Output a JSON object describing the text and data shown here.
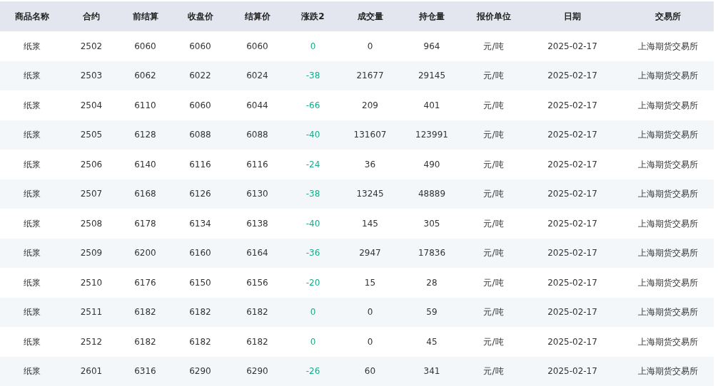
{
  "table": {
    "columns": [
      "商品名称",
      "合约",
      "前结算",
      "收盘价",
      "结算价",
      "涨跌2",
      "成交量",
      "持仓量",
      "报价单位",
      "日期",
      "交易所"
    ],
    "rows": [
      [
        "纸浆",
        "2502",
        "6060",
        "6060",
        "6060",
        "0",
        "0",
        "964",
        "元/吨",
        "2025-02-17",
        "上海期货交易所"
      ],
      [
        "纸浆",
        "2503",
        "6062",
        "6022",
        "6024",
        "-38",
        "21677",
        "29145",
        "元/吨",
        "2025-02-17",
        "上海期货交易所"
      ],
      [
        "纸浆",
        "2504",
        "6110",
        "6060",
        "6044",
        "-66",
        "209",
        "401",
        "元/吨",
        "2025-02-17",
        "上海期货交易所"
      ],
      [
        "纸浆",
        "2505",
        "6128",
        "6088",
        "6088",
        "-40",
        "131607",
        "123991",
        "元/吨",
        "2025-02-17",
        "上海期货交易所"
      ],
      [
        "纸浆",
        "2506",
        "6140",
        "6116",
        "6116",
        "-24",
        "36",
        "490",
        "元/吨",
        "2025-02-17",
        "上海期货交易所"
      ],
      [
        "纸浆",
        "2507",
        "6168",
        "6126",
        "6130",
        "-38",
        "13245",
        "48889",
        "元/吨",
        "2025-02-17",
        "上海期货交易所"
      ],
      [
        "纸浆",
        "2508",
        "6178",
        "6134",
        "6138",
        "-40",
        "145",
        "305",
        "元/吨",
        "2025-02-17",
        "上海期货交易所"
      ],
      [
        "纸浆",
        "2509",
        "6200",
        "6160",
        "6164",
        "-36",
        "2947",
        "17836",
        "元/吨",
        "2025-02-17",
        "上海期货交易所"
      ],
      [
        "纸浆",
        "2510",
        "6176",
        "6150",
        "6156",
        "-20",
        "15",
        "28",
        "元/吨",
        "2025-02-17",
        "上海期货交易所"
      ],
      [
        "纸浆",
        "2511",
        "6182",
        "6182",
        "6182",
        "0",
        "0",
        "59",
        "元/吨",
        "2025-02-17",
        "上海期货交易所"
      ],
      [
        "纸浆",
        "2512",
        "6182",
        "6182",
        "6182",
        "0",
        "0",
        "45",
        "元/吨",
        "2025-02-17",
        "上海期货交易所"
      ],
      [
        "纸浆",
        "2601",
        "6316",
        "6290",
        "6290",
        "-26",
        "60",
        "341",
        "元/吨",
        "2025-02-17",
        "上海期货交易所"
      ]
    ]
  }
}
